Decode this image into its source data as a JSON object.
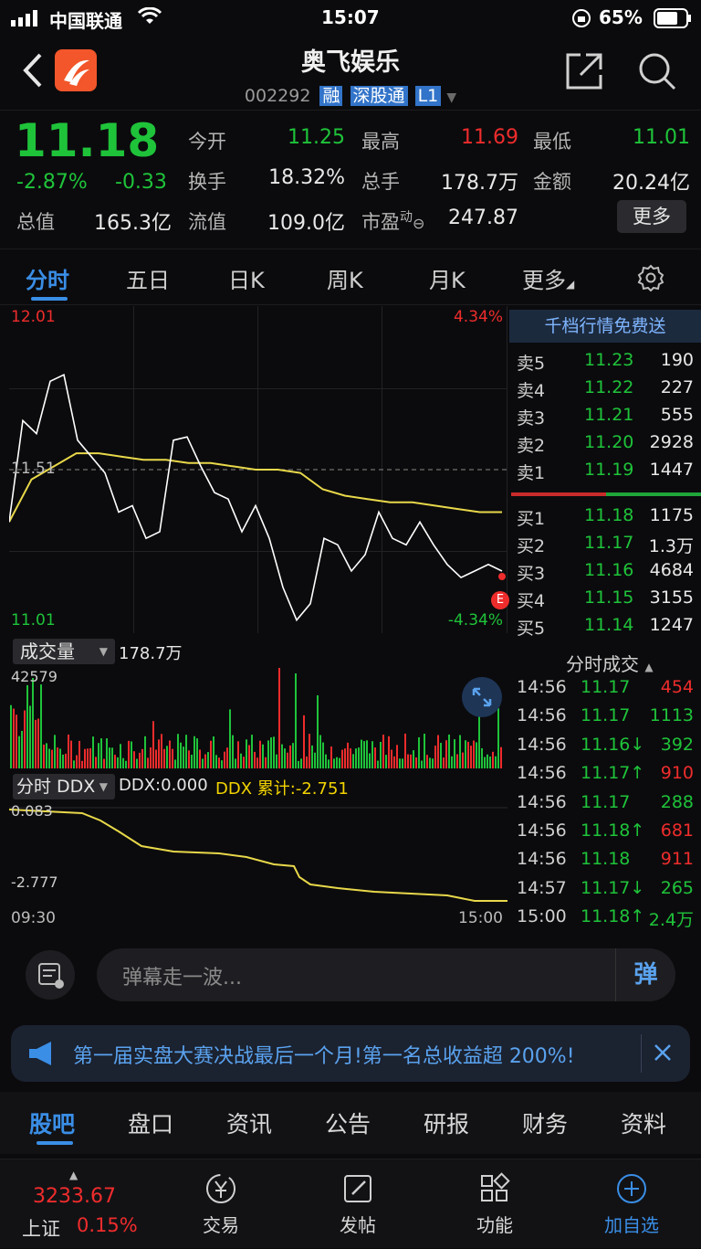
{
  "status_bar": {
    "carrier": "中国联通",
    "time": "15:07",
    "battery": "65%"
  },
  "header": {
    "stock_name": "奥飞娱乐",
    "stock_code": "002292",
    "badges": [
      "融",
      "深股通",
      "L1"
    ]
  },
  "quote": {
    "price": "11.18",
    "change_pct": "-2.87%",
    "change": "-0.33",
    "open_label": "今开",
    "open": "11.25",
    "high_label": "最高",
    "high": "11.69",
    "low_label": "最低",
    "low": "11.01",
    "turnover_label": "换手",
    "turnover": "18.32%",
    "volume_label": "总手",
    "volume": "178.7万",
    "amount_label": "金额",
    "amount": "20.24亿",
    "mktcap_label": "总值",
    "mktcap": "165.3亿",
    "float_label": "流值",
    "float": "109.0亿",
    "pe_label": "市盈",
    "pe_sup": "动",
    "pe": "247.87",
    "more_button": "更多"
  },
  "tabs": [
    "分时",
    "五日",
    "日K",
    "周K",
    "月K",
    "更多"
  ],
  "chart": {
    "price_high": "12.01",
    "price_mid": "11.51",
    "price_low": "11.01",
    "pct_high": "4.34%",
    "pct_low": "-4.34%",
    "volume_selector": "成交量",
    "volume_total": "178.7万",
    "volume_max": "42579",
    "ddx_selector": "分时 DDX",
    "ddx_value": "DDX:0.000",
    "ddx_cum": "DDX 累计:-2.751",
    "ddx_top": "0.083",
    "ddx_bottom": "-2.777",
    "time_start": "09:30",
    "time_end": "15:00"
  },
  "chart_data": {
    "type": "line",
    "ylim": [
      11.01,
      12.01
    ],
    "reference_price": 11.51,
    "price_line": [
      11.35,
      11.66,
      11.62,
      11.78,
      11.8,
      11.6,
      11.55,
      11.5,
      11.38,
      11.4,
      11.3,
      11.32,
      11.6,
      11.61,
      11.52,
      11.44,
      11.42,
      11.32,
      11.4,
      11.3,
      11.15,
      11.05,
      11.1,
      11.3,
      11.28,
      11.2,
      11.25,
      11.38,
      11.3,
      11.28,
      11.35,
      11.28,
      11.22,
      11.18,
      11.2,
      11.22,
      11.2
    ],
    "avg_line": [
      11.35,
      11.48,
      11.52,
      11.56,
      11.56,
      11.55,
      11.54,
      11.54,
      11.53,
      11.53,
      11.52,
      11.51,
      11.51,
      11.5,
      11.45,
      11.43,
      11.42,
      11.41,
      11.41,
      11.4,
      11.39,
      11.38,
      11.38
    ]
  },
  "order_book": {
    "title": "千档行情免费送",
    "asks": [
      {
        "label": "卖5",
        "price": "11.23",
        "qty": "190"
      },
      {
        "label": "卖4",
        "price": "11.22",
        "qty": "227"
      },
      {
        "label": "卖3",
        "price": "11.21",
        "qty": "555"
      },
      {
        "label": "卖2",
        "price": "11.20",
        "qty": "2928"
      },
      {
        "label": "卖1",
        "price": "11.19",
        "qty": "1447"
      }
    ],
    "bids": [
      {
        "label": "买1",
        "price": "11.18",
        "qty": "1175"
      },
      {
        "label": "买2",
        "price": "11.17",
        "qty": "1.3万"
      },
      {
        "label": "买3",
        "price": "11.16",
        "qty": "4684"
      },
      {
        "label": "买4",
        "price": "11.15",
        "qty": "3155"
      },
      {
        "label": "买5",
        "price": "11.14",
        "qty": "1247"
      }
    ]
  },
  "ticks": {
    "title": "分时成交",
    "rows": [
      {
        "time": "14:56",
        "price": "11.17",
        "qty": "454",
        "price_color": "#1fc33a",
        "qty_color": "#ef2c2c"
      },
      {
        "time": "14:56",
        "price": "11.17",
        "qty": "1113",
        "price_color": "#1fc33a",
        "qty_color": "#1fc33a"
      },
      {
        "time": "14:56",
        "price": "11.16↓",
        "qty": "392",
        "price_color": "#1fc33a",
        "qty_color": "#1fc33a"
      },
      {
        "time": "14:56",
        "price": "11.17↑",
        "qty": "910",
        "price_color": "#1fc33a",
        "qty_color": "#ef2c2c"
      },
      {
        "time": "14:56",
        "price": "11.17",
        "qty": "288",
        "price_color": "#1fc33a",
        "qty_color": "#1fc33a"
      },
      {
        "time": "14:56",
        "price": "11.18↑",
        "qty": "681",
        "price_color": "#1fc33a",
        "qty_color": "#ef2c2c"
      },
      {
        "time": "14:56",
        "price": "11.18",
        "qty": "911",
        "price_color": "#1fc33a",
        "qty_color": "#ef2c2c"
      },
      {
        "time": "14:57",
        "price": "11.17↓",
        "qty": "265",
        "price_color": "#1fc33a",
        "qty_color": "#1fc33a"
      },
      {
        "time": "15:00",
        "price": "11.18↑",
        "qty": "2.4万",
        "price_color": "#1fc33a",
        "qty_color": "#1fc33a"
      }
    ]
  },
  "barrage": {
    "placeholder": "弹幕走一波...",
    "send_label": "弹"
  },
  "banner": {
    "text": "第一届实盘大赛决战最后一个月!第一名总收益超 200%!"
  },
  "bottom_tabs": [
    "股吧",
    "盘口",
    "资讯",
    "公告",
    "研报",
    "财务",
    "资料"
  ],
  "bottom_nav": {
    "index_value": "3233.67",
    "index_name": "上证",
    "index_change": "0.15%",
    "items": [
      "交易",
      "发帖",
      "功能",
      "加自选"
    ]
  },
  "colors": {
    "up": "#ef2c2c",
    "down": "#1fc33a",
    "accent": "#3a8ee6",
    "avg_line": "#e8d84a"
  }
}
